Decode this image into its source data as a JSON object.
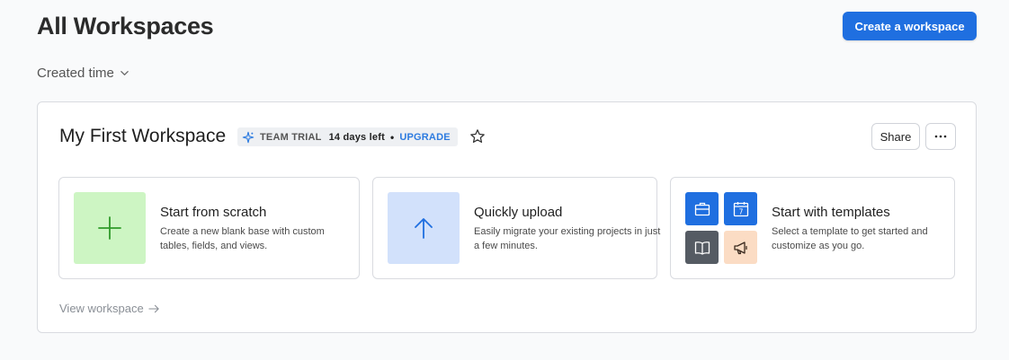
{
  "header": {
    "title": "All Workspaces",
    "create_label": "Create a workspace",
    "sort_label": "Created time"
  },
  "workspace": {
    "name": "My First Workspace",
    "plan": {
      "label": "TEAM TRIAL",
      "days_left": "14 days left",
      "separator": "•",
      "upgrade_label": "UPGRADE"
    },
    "share_label": "Share",
    "view_label": "View workspace",
    "options": [
      {
        "title": "Start from scratch",
        "description": "Create a new blank base with custom tables, fields, and views."
      },
      {
        "title": "Quickly upload",
        "description": "Easily migrate your existing projects in just a few minutes."
      },
      {
        "title": "Start with templates",
        "description": "Select a template to get started and customize as you go."
      }
    ],
    "template_icons": [
      "briefcase-icon",
      "calendar-icon",
      "book-icon",
      "megaphone-icon"
    ],
    "calendar_day": "7"
  },
  "colors": {
    "primary": "#1f6fe0",
    "upgrade": "#2d7be0",
    "scratch_tile": "#cdf5c3",
    "upload_tile": "#d2e1fb",
    "book_tile": "#555b63",
    "megaphone_tile": "#fbdcc4"
  }
}
